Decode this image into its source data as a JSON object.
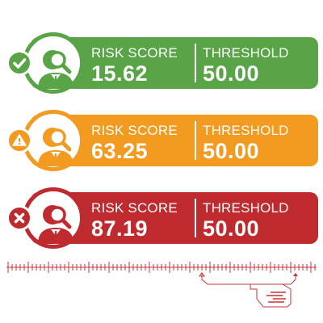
{
  "colors": {
    "low": "#58a447",
    "medium": "#f39a20",
    "high": "#bf2a2f",
    "line": "#c9343a"
  },
  "cards": [
    {
      "level": "low",
      "status_icon": "check-icon",
      "person_icon": "analyst-magnifier-icon",
      "risk_label": "RISK SCORE",
      "risk_value": "15.62",
      "threshold_label": "THRESHOLD",
      "threshold_value": "50.00"
    },
    {
      "level": "medium",
      "status_icon": "warning-icon",
      "person_icon": "analyst-magnifier-icon",
      "risk_label": "RISK SCORE",
      "risk_value": "63.25",
      "threshold_label": "THRESHOLD",
      "threshold_value": "50.00"
    },
    {
      "level": "high",
      "status_icon": "x-icon",
      "person_icon": "analyst-magnifier-icon",
      "risk_label": "RISK SCORE",
      "risk_value": "87.19",
      "threshold_label": "THRESHOLD",
      "threshold_value": "50.00"
    }
  ]
}
